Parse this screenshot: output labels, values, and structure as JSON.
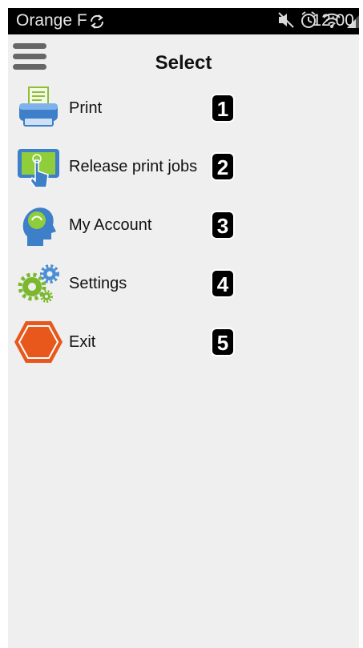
{
  "status_bar": {
    "carrier": "Orange F",
    "time": "12:00",
    "icons": [
      "sync-icon",
      "mute-icon",
      "alarm-icon",
      "wifi-icon",
      "signal-icon",
      "battery-icon"
    ]
  },
  "header": {
    "title": "Select",
    "menu_icon": "hamburger-menu-icon"
  },
  "menu": {
    "items": [
      {
        "label": "Print",
        "number": "1",
        "icon": "printer-icon"
      },
      {
        "label": "Release print jobs",
        "number": "2",
        "icon": "touch-screen-icon"
      },
      {
        "label": "My Account",
        "number": "3",
        "icon": "user-head-icon"
      },
      {
        "label": "Settings",
        "number": "4",
        "icon": "gears-icon"
      },
      {
        "label": "Exit",
        "number": "5",
        "icon": "exit-hexagon-icon"
      }
    ]
  },
  "colors": {
    "status_bar": "#000000",
    "background": "#efefef",
    "exit_orange": "#e8581c",
    "settings_green": "#7cb82f",
    "settings_blue": "#4a8fd4",
    "print_blue": "#3d7fc9",
    "badge": "#000000"
  }
}
